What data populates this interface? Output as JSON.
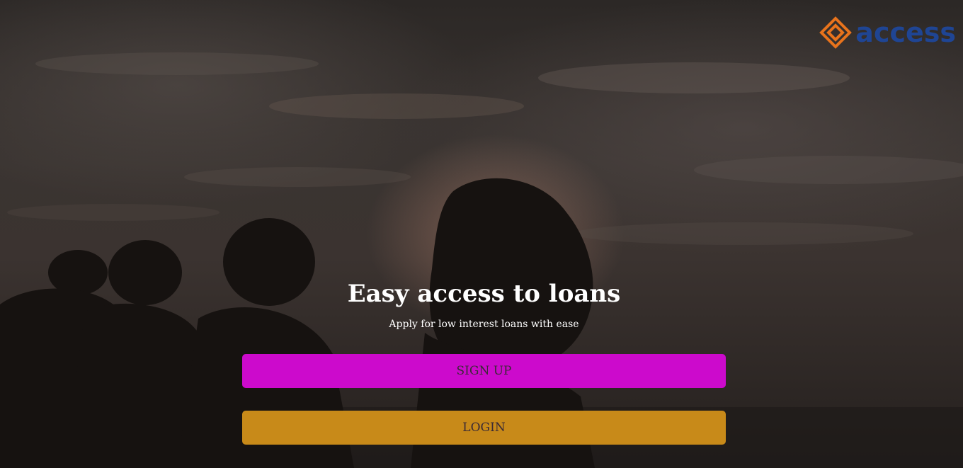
{
  "brand": {
    "logo_text": "access",
    "logo_icon": "access-diamond-logo-icon",
    "logo_word_color": "#1f4594",
    "logo_mark_color": "#e8731c"
  },
  "hero": {
    "headline": "Easy access to loans",
    "subline": "Apply for low interest loans with ease",
    "background_image": "silhouettes-of-people-at-sunset"
  },
  "actions": {
    "signup_label": "SIGN UP",
    "login_label": "LOGIN",
    "signup_color": "#cc0acc",
    "login_color": "#c88a19"
  }
}
